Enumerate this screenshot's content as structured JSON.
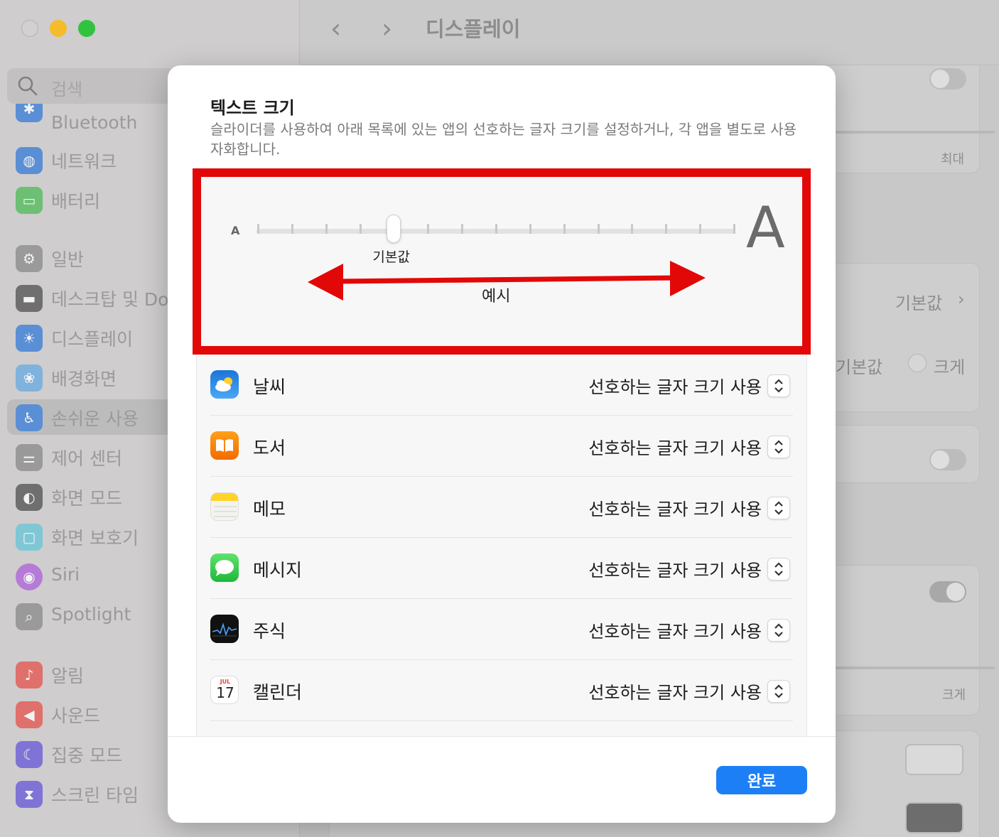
{
  "window": {
    "page_title": "디스플레이"
  },
  "sidebar": {
    "search_placeholder": "검색",
    "items": [
      {
        "label": "Bluetooth",
        "icon": "bluetooth-icon",
        "color": "#5a8fd6"
      },
      {
        "label": "네트워크",
        "icon": "globe-icon",
        "color": "#5a8fd6"
      },
      {
        "label": "배터리",
        "icon": "battery-icon",
        "color": "#6cbf73"
      },
      {
        "label": "일반",
        "icon": "gear-icon",
        "color": "#9a9a9a"
      },
      {
        "label": "데스크탑 및 Dock",
        "icon": "dock-icon",
        "color": "#6f6f6f"
      },
      {
        "label": "디스플레이",
        "icon": "sun-icon",
        "color": "#5a8fd6"
      },
      {
        "label": "배경화면",
        "icon": "flower-icon",
        "color": "#7fb2dc"
      },
      {
        "label": "손쉬운 사용",
        "icon": "accessibility-icon",
        "color": "#5a8fd6"
      },
      {
        "label": "제어 센터",
        "icon": "switches-icon",
        "color": "#9a9a9a"
      },
      {
        "label": "화면 모드",
        "icon": "appearance-icon",
        "color": "#6f6f6f"
      },
      {
        "label": "화면 보호기",
        "icon": "screensaver-icon",
        "color": "#80c7d6"
      },
      {
        "label": "Siri",
        "icon": "siri-icon",
        "color": "#b57bd6"
      },
      {
        "label": "Spotlight",
        "icon": "magnifier-icon",
        "color": "#9a9a9a"
      },
      {
        "label": "알림",
        "icon": "bell-icon",
        "color": "#e0706b"
      },
      {
        "label": "사운드",
        "icon": "speaker-icon",
        "color": "#e0706b"
      },
      {
        "label": "집중 모드",
        "icon": "moon-icon",
        "color": "#7f74d6"
      },
      {
        "label": "스크린 타임",
        "icon": "hourglass-icon",
        "color": "#7f74d6"
      }
    ]
  },
  "background_main": {
    "max_label": "최대",
    "default_row_value": "기본값",
    "radio_default": "기본값",
    "radio_large": "크게",
    "large_label": "크게"
  },
  "modal": {
    "title": "텍스트 크기",
    "description": "슬라이더를 사용하여 아래 목록에 있는 앱의 선호하는 글자 크기를 설정하거나, 각 앱을 별도로 사용자화합니다.",
    "slider": {
      "small_label": "A",
      "large_label": "A",
      "default_label": "기본값",
      "example_label": "예시",
      "tick_count": 15,
      "selected_step": 4
    },
    "apps": [
      {
        "name": "날씨",
        "value": "선호하는 글자 크기 사용",
        "icon": "weather-icon"
      },
      {
        "name": "도서",
        "value": "선호하는 글자 크기 사용",
        "icon": "books-icon"
      },
      {
        "name": "메모",
        "value": "선호하는 글자 크기 사용",
        "icon": "notes-icon"
      },
      {
        "name": "메시지",
        "value": "선호하는 글자 크기 사용",
        "icon": "messages-icon"
      },
      {
        "name": "주식",
        "value": "선호하는 글자 크기 사용",
        "icon": "stocks-icon"
      },
      {
        "name": "캘린더",
        "value": "선호하는 글자 크기 사용",
        "icon": "calendar-icon",
        "calendar_month": "JUL",
        "calendar_day": "17"
      }
    ],
    "done_label": "완료"
  },
  "colors": {
    "accent": "#1c7ff6",
    "annotation_red": "#e20808"
  }
}
